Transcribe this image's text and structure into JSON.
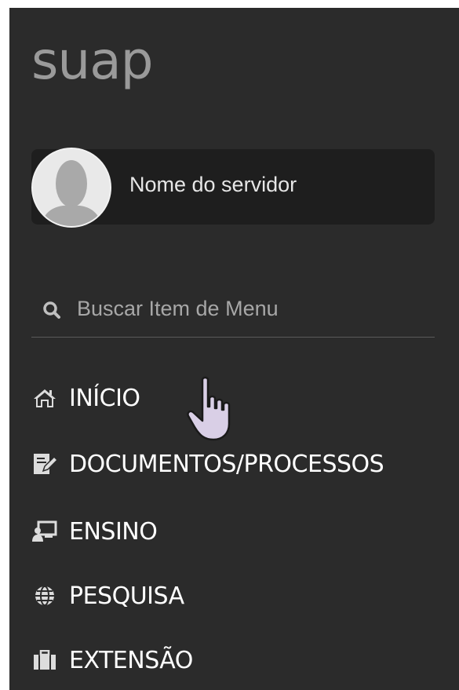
{
  "logo": {
    "text": "suap"
  },
  "user": {
    "name": "Nome do servidor"
  },
  "search": {
    "placeholder": "Buscar Item de Menu"
  },
  "menu": {
    "items": [
      {
        "label": "INÍCIO",
        "icon": "home-icon"
      },
      {
        "label": "DOCUMENTOS/PROCESSOS",
        "icon": "document-edit-icon"
      },
      {
        "label": "ENSINO",
        "icon": "teacher-board-icon"
      },
      {
        "label": "PESQUISA",
        "icon": "globe-icon"
      },
      {
        "label": "EXTENSÃO",
        "icon": "briefcase-icon"
      }
    ]
  },
  "colors": {
    "sidebar_bg": "#2b2b2b",
    "card_bg": "#1e1e1e",
    "logo": "#9a9a9a",
    "menu_text": "#ffffff",
    "cursor_fill": "#d9cfe6"
  }
}
